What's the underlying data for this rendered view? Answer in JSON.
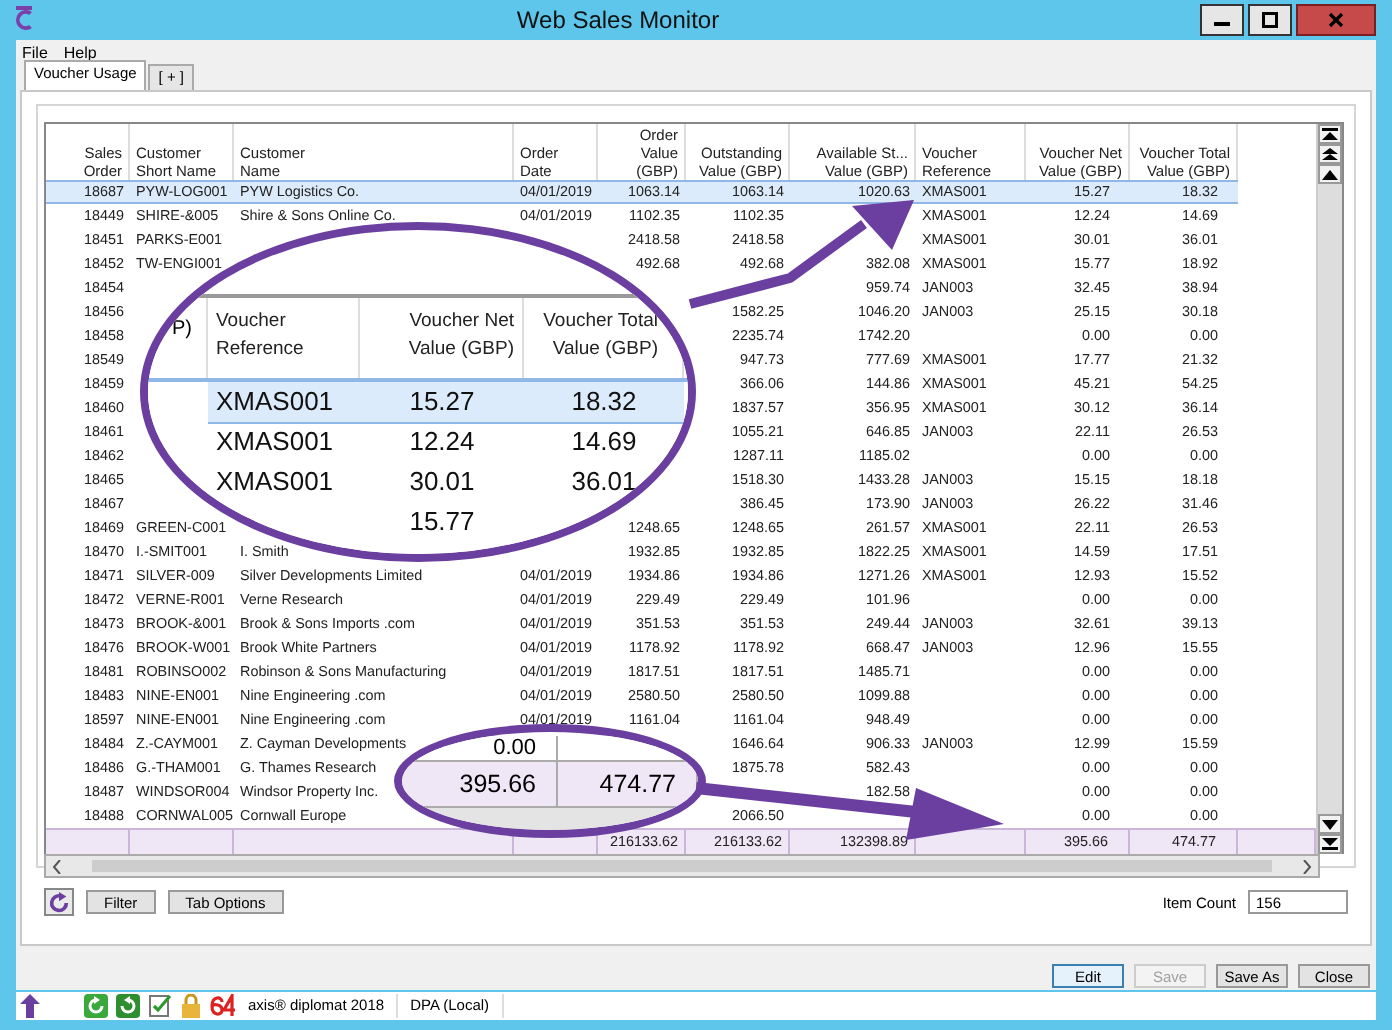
{
  "window": {
    "title": "Web Sales Monitor"
  },
  "menu": [
    "File",
    "Help"
  ],
  "tabs": [
    {
      "label": "Voucher Usage",
      "selected": true
    },
    {
      "label": "[ + ]",
      "selected": false
    }
  ],
  "table": {
    "columns": [
      "Sales\nOrder",
      "Customer\nShort Name",
      "Customer\nName",
      "Order\nDate",
      "Order\nValue\n(GBP)",
      "Outstanding\nValue (GBP)",
      "Available St...\nValue (GBP)",
      "Voucher\nReference",
      "Voucher Net\nValue (GBP)",
      "Voucher Total\nValue (GBP)"
    ],
    "rows": [
      {
        "selected": true,
        "cells": [
          "18687",
          "PYW-LOG001",
          "PYW Logistics Co.",
          "04/01/2019",
          "1063.14",
          "1063.14",
          "1020.63",
          "XMAS001",
          "15.27",
          "18.32"
        ]
      },
      {
        "selected": false,
        "cells": [
          "18449",
          "SHIRE-&005",
          "Shire & Sons Online Co.",
          "04/01/2019",
          "1102.35",
          "1102.35",
          null,
          "XMAS001",
          "12.24",
          "14.69"
        ]
      },
      {
        "selected": false,
        "cells": [
          "18451",
          "PARKS-E001",
          null,
          null,
          "2418.58",
          "2418.58",
          null,
          "XMAS001",
          "30.01",
          "36.01"
        ]
      },
      {
        "selected": false,
        "cells": [
          "18452",
          "TW-ENGI001",
          null,
          null,
          "492.68",
          "492.68",
          "382.08",
          "XMAS001",
          "15.77",
          "18.92"
        ]
      },
      {
        "selected": false,
        "cells": [
          "18454",
          null,
          null,
          null,
          null,
          null,
          "959.74",
          "JAN003",
          "32.45",
          "38.94"
        ]
      },
      {
        "selected": false,
        "cells": [
          "18456",
          null,
          null,
          null,
          null,
          "1582.25",
          "1046.20",
          "JAN003",
          "25.15",
          "30.18"
        ]
      },
      {
        "selected": false,
        "cells": [
          "18458",
          null,
          null,
          null,
          null,
          "2235.74",
          "1742.20",
          null,
          "0.00",
          "0.00"
        ]
      },
      {
        "selected": false,
        "cells": [
          "18549",
          null,
          null,
          null,
          null,
          "947.73",
          "777.69",
          "XMAS001",
          "17.77",
          "21.32"
        ]
      },
      {
        "selected": false,
        "cells": [
          "18459",
          null,
          null,
          null,
          null,
          "366.06",
          "144.86",
          "XMAS001",
          "45.21",
          "54.25"
        ]
      },
      {
        "selected": false,
        "cells": [
          "18460",
          null,
          null,
          null,
          null,
          "1837.57",
          "356.95",
          "XMAS001",
          "30.12",
          "36.14"
        ]
      },
      {
        "selected": false,
        "cells": [
          "18461",
          null,
          null,
          null,
          null,
          "1055.21",
          "646.85",
          "JAN003",
          "22.11",
          "26.53"
        ]
      },
      {
        "selected": false,
        "cells": [
          "18462",
          null,
          null,
          null,
          null,
          "1287.11",
          "1185.02",
          null,
          "0.00",
          "0.00"
        ]
      },
      {
        "selected": false,
        "cells": [
          "18465",
          null,
          null,
          null,
          null,
          "1518.30",
          "1433.28",
          "JAN003",
          "15.15",
          "18.18"
        ]
      },
      {
        "selected": false,
        "cells": [
          "18467",
          null,
          null,
          null,
          null,
          "386.45",
          "173.90",
          "JAN003",
          "26.22",
          "31.46"
        ]
      },
      {
        "selected": false,
        "cells": [
          "18469",
          "GREEN-C001",
          null,
          null,
          "1248.65",
          "1248.65",
          "261.57",
          "XMAS001",
          "22.11",
          "26.53"
        ]
      },
      {
        "selected": false,
        "cells": [
          "18470",
          "I.-SMIT001",
          "I. Smith",
          null,
          "1932.85",
          "1932.85",
          "1822.25",
          "XMAS001",
          "14.59",
          "17.51"
        ]
      },
      {
        "selected": false,
        "cells": [
          "18471",
          "SILVER-009",
          "Silver Developments Limited",
          "04/01/2019",
          "1934.86",
          "1934.86",
          "1271.26",
          "XMAS001",
          "12.93",
          "15.52"
        ]
      },
      {
        "selected": false,
        "cells": [
          "18472",
          "VERNE-R001",
          "Verne Research",
          "04/01/2019",
          "229.49",
          "229.49",
          "101.96",
          null,
          "0.00",
          "0.00"
        ]
      },
      {
        "selected": false,
        "cells": [
          "18473",
          "BROOK-&001",
          "Brook & Sons Imports .com",
          "04/01/2019",
          "351.53",
          "351.53",
          "249.44",
          "JAN003",
          "32.61",
          "39.13"
        ]
      },
      {
        "selected": false,
        "cells": [
          "18476",
          "BROOK-W001",
          "Brook White Partners",
          "04/01/2019",
          "1178.92",
          "1178.92",
          "668.47",
          "JAN003",
          "12.96",
          "15.55"
        ]
      },
      {
        "selected": false,
        "cells": [
          "18481",
          "ROBINSO002",
          "Robinson & Sons Manufacturing",
          "04/01/2019",
          "1817.51",
          "1817.51",
          "1485.71",
          null,
          "0.00",
          "0.00"
        ]
      },
      {
        "selected": false,
        "cells": [
          "18483",
          "NINE-EN001",
          "Nine Engineering .com",
          "04/01/2019",
          "2580.50",
          "2580.50",
          "1099.88",
          null,
          "0.00",
          "0.00"
        ]
      },
      {
        "selected": false,
        "cells": [
          "18597",
          "NINE-EN001",
          "Nine Engineering .com",
          "04/01/2019",
          "1161.04",
          "1161.04",
          "948.49",
          null,
          "0.00",
          "0.00"
        ]
      },
      {
        "selected": false,
        "cells": [
          "18484",
          "Z.-CAYM001",
          "Z. Cayman Developments",
          null,
          null,
          "1646.64",
          "906.33",
          "JAN003",
          "12.99",
          "15.59"
        ]
      },
      {
        "selected": false,
        "cells": [
          "18486",
          "G.-THAM001",
          "G. Thames Research",
          null,
          null,
          "1875.78",
          "582.43",
          null,
          "0.00",
          "0.00"
        ]
      },
      {
        "selected": false,
        "cells": [
          "18487",
          "WINDSOR004",
          "Windsor Property Inc.",
          null,
          null,
          null,
          "182.58",
          null,
          "0.00",
          "0.00"
        ]
      },
      {
        "selected": false,
        "cells": [
          "18488",
          "CORNWAL005",
          "Cornwall Europe",
          null,
          null,
          "2066.50",
          null,
          null,
          "0.00",
          "0.00"
        ]
      }
    ],
    "totals": {
      "order_value": "216133.62",
      "outstanding": "216133.62",
      "available": "132398.89",
      "voucher_net": "395.66",
      "voucher_total": "474.77"
    }
  },
  "callout_top": {
    "fragment": "P)",
    "columns": [
      "Voucher\nReference",
      "Voucher Net\nValue (GBP)",
      "Voucher Total\nValue (GBP)"
    ],
    "rows": [
      {
        "selected": true,
        "cells": [
          "XMAS001",
          "15.27",
          "18.32"
        ]
      },
      {
        "selected": false,
        "cells": [
          "XMAS001",
          "12.24",
          "14.69"
        ]
      },
      {
        "selected": false,
        "cells": [
          "XMAS001",
          "30.01",
          "36.01"
        ]
      },
      {
        "selected": false,
        "cells": [
          null,
          "15.77",
          null
        ]
      }
    ]
  },
  "callout_bottom": {
    "rows": [
      {
        "kind": "plain",
        "cells": [
          "0.00"
        ]
      },
      {
        "kind": "total",
        "cells": [
          "395.66",
          "474.77"
        ]
      }
    ]
  },
  "footer": {
    "buttons": [
      "Filter",
      "Tab Options"
    ],
    "item_count_label": "Item Count",
    "item_count": "156"
  },
  "actions": [
    {
      "label": "Edit",
      "disabled": false
    },
    {
      "label": "Save",
      "disabled": true
    },
    {
      "label": "Save As",
      "disabled": false
    },
    {
      "label": "Close",
      "disabled": false
    }
  ],
  "status_bar": {
    "texts": [
      "axis® diplomat 2018",
      "DPA (Local)"
    ]
  }
}
